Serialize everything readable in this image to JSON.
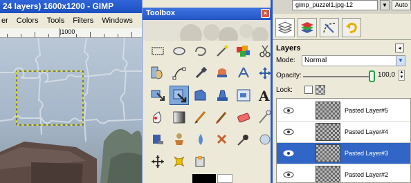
{
  "image_window": {
    "title": "24 layers) 1600x1200 - GIMP",
    "menu": [
      "er",
      "Colors",
      "Tools",
      "Filters",
      "Windows"
    ],
    "ruler_label": "|1000"
  },
  "toolbox": {
    "title": "Toolbox",
    "close_glyph": "×",
    "tools": [
      "rect-select-icon",
      "ellipse-select-icon",
      "free-select-icon",
      "fuzzy-select-icon",
      "color-select-icon",
      "scissors-icon",
      "foreground-select-icon",
      "paths-icon",
      "color-picker-icon",
      "zoom-icon",
      "measure-icon",
      "move-icon",
      "align-icon",
      "transform-icon",
      "rotate-icon",
      "scale-icon",
      "shear-icon",
      "text-icon",
      "perspective-icon",
      "flip-icon",
      "bucket-fill-icon",
      "blend-icon",
      "pencil-icon",
      "paintbrush-icon",
      "eraser-icon",
      "airbrush-icon",
      "ink-icon",
      "clone-icon",
      "heal-icon",
      "smudge-icon",
      "dodge-icon",
      "crop-icon",
      "cage-icon"
    ],
    "active_tool_index": 13
  },
  "dock": {
    "file_label": "gimp_puzzel1.jpg-12",
    "auto_label": "Auto",
    "title": "Layers",
    "mode_label": "Mode:",
    "mode_value": "Normal",
    "opacity_label": "Opacity:",
    "opacity_value": "100,0",
    "lock_label": "Lock:",
    "layers": [
      {
        "name": "Pasted Layer#5",
        "selected": false
      },
      {
        "name": "Pasted Layer#4",
        "selected": false
      },
      {
        "name": "Pasted Layer#3",
        "selected": true
      },
      {
        "name": "Pasted Layer#2",
        "selected": false
      }
    ]
  },
  "colors": {
    "titlebar": "#2456c6",
    "selected_layer": "#3166c6",
    "opacity_knob": "#2ea04a"
  }
}
